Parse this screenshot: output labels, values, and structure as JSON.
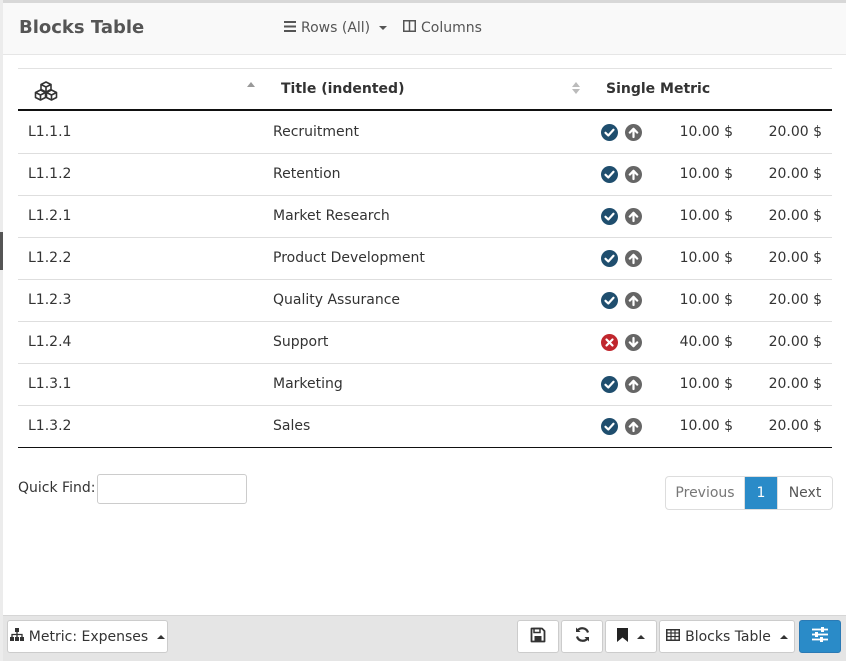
{
  "header": {
    "title": "Blocks Table",
    "rows_label": "Rows (All)",
    "columns_label": "Columns"
  },
  "table": {
    "columns": [
      "",
      "Title (indented)",
      "Single Metric"
    ],
    "rows": [
      {
        "id": "L1.1.1",
        "title": "Recruitment",
        "status": "ok",
        "trend": "up",
        "value1": "10.00 $",
        "value2": "20.00 $"
      },
      {
        "id": "L1.1.2",
        "title": "Retention",
        "status": "ok",
        "trend": "up",
        "value1": "10.00 $",
        "value2": "20.00 $"
      },
      {
        "id": "L1.2.1",
        "title": "Market Research",
        "status": "ok",
        "trend": "up",
        "value1": "10.00 $",
        "value2": "20.00 $"
      },
      {
        "id": "L1.2.2",
        "title": "Product Development",
        "status": "ok",
        "trend": "up",
        "value1": "10.00 $",
        "value2": "20.00 $"
      },
      {
        "id": "L1.2.3",
        "title": "Quality Assurance",
        "status": "ok",
        "trend": "up",
        "value1": "10.00 $",
        "value2": "20.00 $"
      },
      {
        "id": "L1.2.4",
        "title": "Support",
        "status": "error",
        "trend": "down",
        "value1": "40.00 $",
        "value2": "20.00 $"
      },
      {
        "id": "L1.3.1",
        "title": "Marketing",
        "status": "ok",
        "trend": "up",
        "value1": "10.00 $",
        "value2": "20.00 $"
      },
      {
        "id": "L1.3.2",
        "title": "Sales",
        "status": "ok",
        "trend": "up",
        "value1": "10.00 $",
        "value2": "20.00 $"
      }
    ]
  },
  "quick_find": {
    "label": "Quick Find:",
    "value": ""
  },
  "pagination": {
    "previous": "Previous",
    "current": "1",
    "next": "Next"
  },
  "footer": {
    "metric_label": "Metric: Expenses",
    "view_label": "Blocks Table"
  },
  "colors": {
    "accent": "#2a8bc8",
    "status_ok": "#1f4e6e",
    "status_error": "#c0262d",
    "trend": "#666666"
  },
  "icons": {
    "header_column_icon": "cubes-icon",
    "rows_icon": "bars-icon",
    "columns_icon": "columns-icon",
    "metric_icon": "sitemap-icon",
    "save_icon": "floppy-disk-icon",
    "refresh_icon": "refresh-icon",
    "bookmark_icon": "bookmark-icon",
    "view_icon": "table-icon",
    "settings_icon": "sliders-icon"
  }
}
